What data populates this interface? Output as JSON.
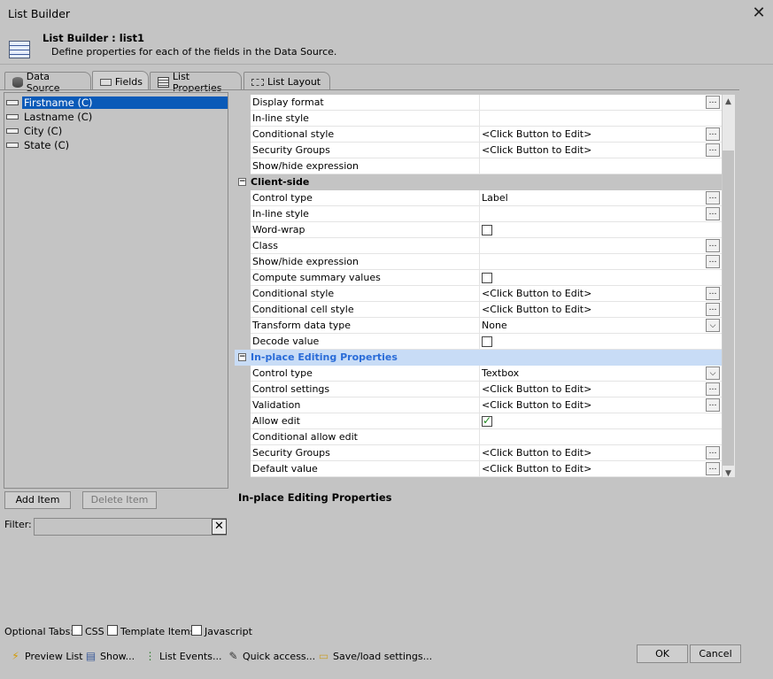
{
  "window": {
    "title": "List Builder",
    "close_glyph": "✕"
  },
  "header": {
    "title": "List Builder : list1",
    "subtitle": "Define properties for each of the fields in the Data Source."
  },
  "tabs": [
    {
      "label": "Data Source",
      "icon": "database-icon"
    },
    {
      "label": "Fields",
      "icon": "field-icon",
      "active": true
    },
    {
      "label": "List Properties",
      "icon": "list-properties-icon"
    },
    {
      "label": "List Layout",
      "icon": "list-layout-icon"
    }
  ],
  "fields": [
    {
      "label": "Firstname (C)",
      "selected": true
    },
    {
      "label": "Lastname (C)"
    },
    {
      "label": "City (C)"
    },
    {
      "label": "State (C)"
    }
  ],
  "properties": {
    "top_rows": [
      {
        "name": "Display format",
        "value": "",
        "button": "…"
      },
      {
        "name": "In-line style",
        "value": ""
      },
      {
        "name": "Conditional style",
        "value": "<Click Button to Edit>",
        "button": "…"
      },
      {
        "name": "Security Groups",
        "value": "<Click Button to Edit>",
        "button": "…"
      },
      {
        "name": "Show/hide expression",
        "value": ""
      }
    ],
    "client_side": {
      "label": "Client-side",
      "rows": [
        {
          "name": "Control type",
          "value": "Label",
          "button": "…"
        },
        {
          "name": "In-line style",
          "value": "",
          "button": "…"
        },
        {
          "name": "Word-wrap",
          "checkbox": false
        },
        {
          "name": "Class",
          "value": "",
          "button": "…"
        },
        {
          "name": "Show/hide expression",
          "value": "",
          "button": "…"
        },
        {
          "name": "Compute summary values",
          "checkbox": false
        },
        {
          "name": "Conditional style",
          "value": "<Click Button to Edit>",
          "button": "…"
        },
        {
          "name": "Conditional cell style",
          "value": "<Click Button to Edit>",
          "button": "…"
        },
        {
          "name": "Transform data type",
          "value": "None",
          "dropdown": "⌵"
        },
        {
          "name": "Decode value",
          "checkbox": false
        }
      ]
    },
    "inplace": {
      "label": "In-place Editing Properties",
      "rows": [
        {
          "name": "Control type",
          "value": "Textbox",
          "dropdown": "⌵"
        },
        {
          "name": "Control settings",
          "value": "<Click Button to Edit>",
          "button": "…"
        },
        {
          "name": "Validation",
          "value": "<Click Button to Edit>",
          "button": "…"
        },
        {
          "name": "Allow edit",
          "checkbox": true
        },
        {
          "name": "Conditional allow edit",
          "value": ""
        },
        {
          "name": "Security Groups",
          "value": "<Click Button to Edit>",
          "button": "…"
        },
        {
          "name": "Default value",
          "value": "<Click Button to Edit>",
          "button": "…"
        }
      ]
    },
    "toggle_glyph": "−"
  },
  "scroll": {
    "up": "▲",
    "down": "▼"
  },
  "description": "In-place Editing Properties",
  "buttons": {
    "add_item": "Add Item",
    "delete_item": "Delete Item",
    "ok": "OK",
    "cancel": "Cancel"
  },
  "filter": {
    "label": "Filter:",
    "value": "",
    "clear": "✕"
  },
  "optional_tabs": {
    "label": "Optional Tabs:",
    "items": [
      {
        "label": "CSS",
        "checked": false
      },
      {
        "label": "Template Items",
        "checked": false
      },
      {
        "label": "Javascript",
        "checked": false
      }
    ]
  },
  "toolbar": [
    {
      "label": "Preview List",
      "icon": "lightning-icon",
      "glyph": "⚡"
    },
    {
      "label": "Show...",
      "icon": "show-icon",
      "glyph": "▤"
    },
    {
      "label": "List Events...",
      "icon": "events-icon",
      "glyph": "⋮"
    },
    {
      "label": "Quick access...",
      "icon": "quick-access-icon",
      "glyph": "✎"
    },
    {
      "label": "Save/load settings...",
      "icon": "folder-icon",
      "glyph": "▭"
    }
  ],
  "colors": {
    "selection": "#0a5ab8",
    "highlight_category": "#c8dcf6",
    "highlight_text": "#2a6cd8"
  }
}
